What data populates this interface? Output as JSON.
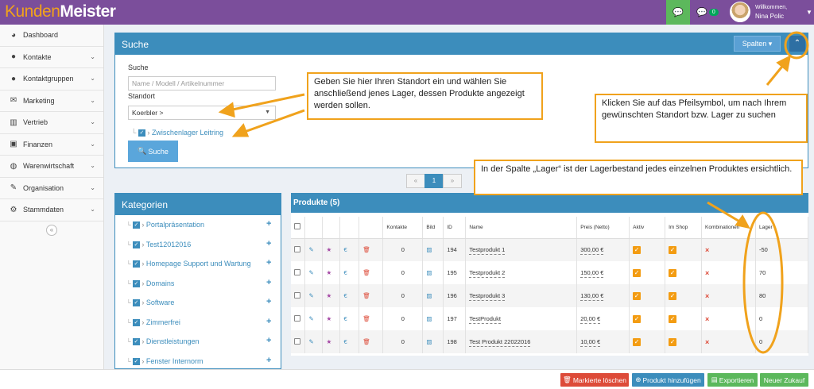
{
  "app": {
    "logo_part1": "Kunden",
    "logo_part2": "Meister"
  },
  "topbar": {
    "notif_count": "0",
    "welcome": "Willkommen,",
    "user_name": "Nina Polic"
  },
  "sidebar": {
    "items": [
      {
        "label": "Dashboard",
        "icon": "dashboard-icon",
        "glyph": "◕"
      },
      {
        "label": "Kontakte",
        "icon": "user-icon",
        "glyph": "●"
      },
      {
        "label": "Kontaktgruppen",
        "icon": "users-icon",
        "glyph": "●"
      },
      {
        "label": "Marketing",
        "icon": "envelope-icon",
        "glyph": "✉"
      },
      {
        "label": "Vertrieb",
        "icon": "bar-chart-icon",
        "glyph": "▥"
      },
      {
        "label": "Finanzen",
        "icon": "money-icon",
        "glyph": "▣"
      },
      {
        "label": "Warenwirtschaft",
        "icon": "globe-icon",
        "glyph": "◍"
      },
      {
        "label": "Organisation",
        "icon": "edit-icon",
        "glyph": "✎"
      },
      {
        "label": "Stammdaten",
        "icon": "cogs-icon",
        "glyph": "⚙"
      }
    ],
    "collapse": "«"
  },
  "search": {
    "title": "Suche",
    "columns_button": "Spalten ▾",
    "search_label": "Suche",
    "search_placeholder": "Name / Modell / Artikelnummer",
    "standort_label": "Standort",
    "standort_value": "Koerbler >",
    "tree_item": "Zwischenlager Leitring",
    "submit": "Suche"
  },
  "pager": {
    "prev": "«",
    "current": "1",
    "next": "»"
  },
  "categories": {
    "title": "Kategorien",
    "items": [
      "Portalpräsentation",
      "Test12012016",
      "Homepage Support und Wartung",
      "Domains",
      "Software",
      "Zimmerfrei",
      "Dienstleistungen",
      "Fenster Internorm"
    ]
  },
  "products": {
    "title": "Produkte (5)",
    "headers": {
      "kontakte": "Kontakte",
      "bild": "Bild",
      "id": "ID",
      "name": "Name",
      "preis": "Preis (Netto)",
      "aktiv": "Aktiv",
      "shop": "Im Shop",
      "kombi": "Kombinationen",
      "lager": "Lager"
    },
    "rows": [
      {
        "kontakte": "0",
        "id": "194",
        "name": "Testprodukt 1",
        "preis": "300,00 €",
        "lager": "-50"
      },
      {
        "kontakte": "0",
        "id": "195",
        "name": "Testprodukt 2",
        "preis": "150,00 €",
        "lager": "70"
      },
      {
        "kontakte": "0",
        "id": "196",
        "name": "Testprodukt 3",
        "preis": "130,00 €",
        "lager": "80"
      },
      {
        "kontakte": "0",
        "id": "197",
        "name": "TestProdukt",
        "preis": "20,00 €",
        "lager": "0"
      },
      {
        "kontakte": "0",
        "id": "198",
        "name": "Test Produkt 22022016",
        "preis": "10,00 €",
        "lager": "0"
      }
    ]
  },
  "bottom": {
    "delete": "Markierte löschen",
    "add": "Produkt hinzufügen",
    "export": "Exportieren",
    "purchase": "Neuer Zukauf"
  },
  "callouts": {
    "standort": "Geben Sie hier Ihren Standort ein und wählen Sie anschließend  jenes Lager, dessen Produkte angezeigt werden sollen.",
    "pfeil": "Klicken Sie auf das Pfeilsymbol, um nach Ihrem gewünschten Standort bzw. Lager zu suchen",
    "lager": "In der Spalte „Lager“ ist der Lagerbestand jedes einzelnen Produktes ersichtlich."
  },
  "colors": {
    "topbar": "#7b4e9b",
    "primary": "#3c8dbc",
    "accent": "#f0a21c",
    "danger": "#dd4b39",
    "success": "#5cb85c"
  }
}
